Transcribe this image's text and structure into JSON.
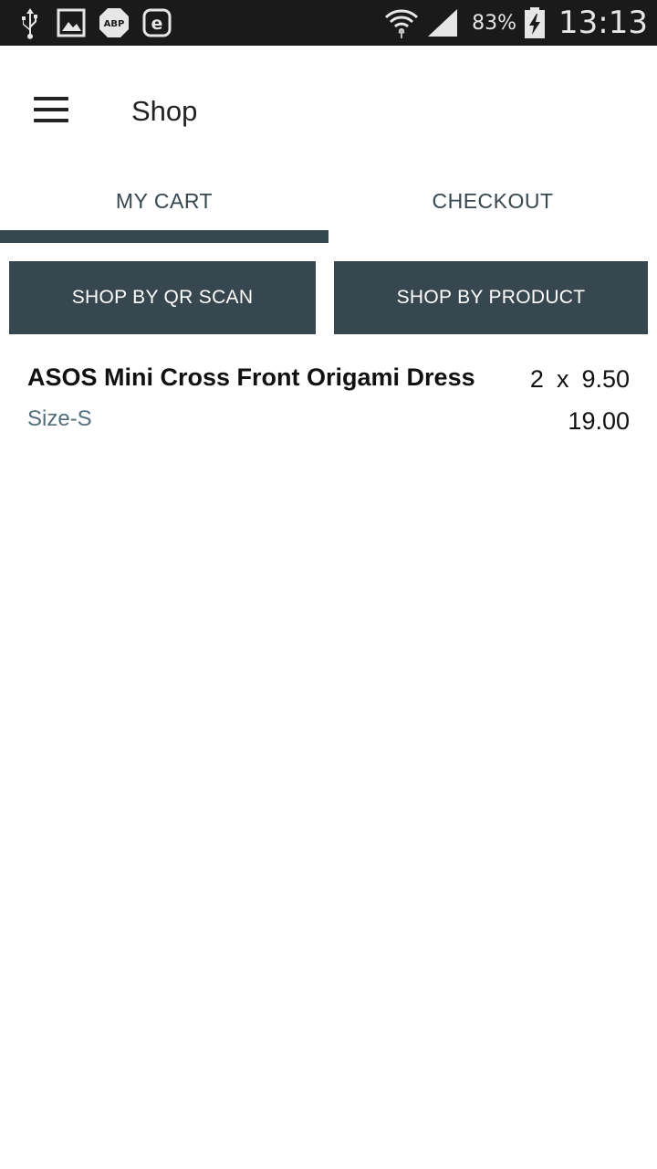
{
  "status_bar": {
    "icons_left": [
      "usb-icon",
      "image-icon",
      "abp-icon",
      "e-icon"
    ],
    "icons_right": [
      "wifi-icon",
      "signal-icon",
      "battery-charging-icon"
    ],
    "battery_percent": "83%",
    "time": "13:13"
  },
  "app_bar": {
    "menu_icon": "hamburger-menu-icon",
    "title": "Shop"
  },
  "tabs": [
    {
      "label": "MY CART",
      "selected": true
    },
    {
      "label": "CHECKOUT",
      "selected": false
    }
  ],
  "actions": {
    "qr_scan_label": "SHOP BY QR SCAN",
    "product_label": "SHOP BY PRODUCT"
  },
  "cart": {
    "items": [
      {
        "name": "ASOS Mini Cross Front Origami Dress",
        "size": "Size-S",
        "quantity": "2",
        "times": "x",
        "unit_price": "9.50",
        "total": "19.00"
      }
    ]
  },
  "colors": {
    "accent": "#37474f",
    "status_bar": "#1a1a1a"
  }
}
